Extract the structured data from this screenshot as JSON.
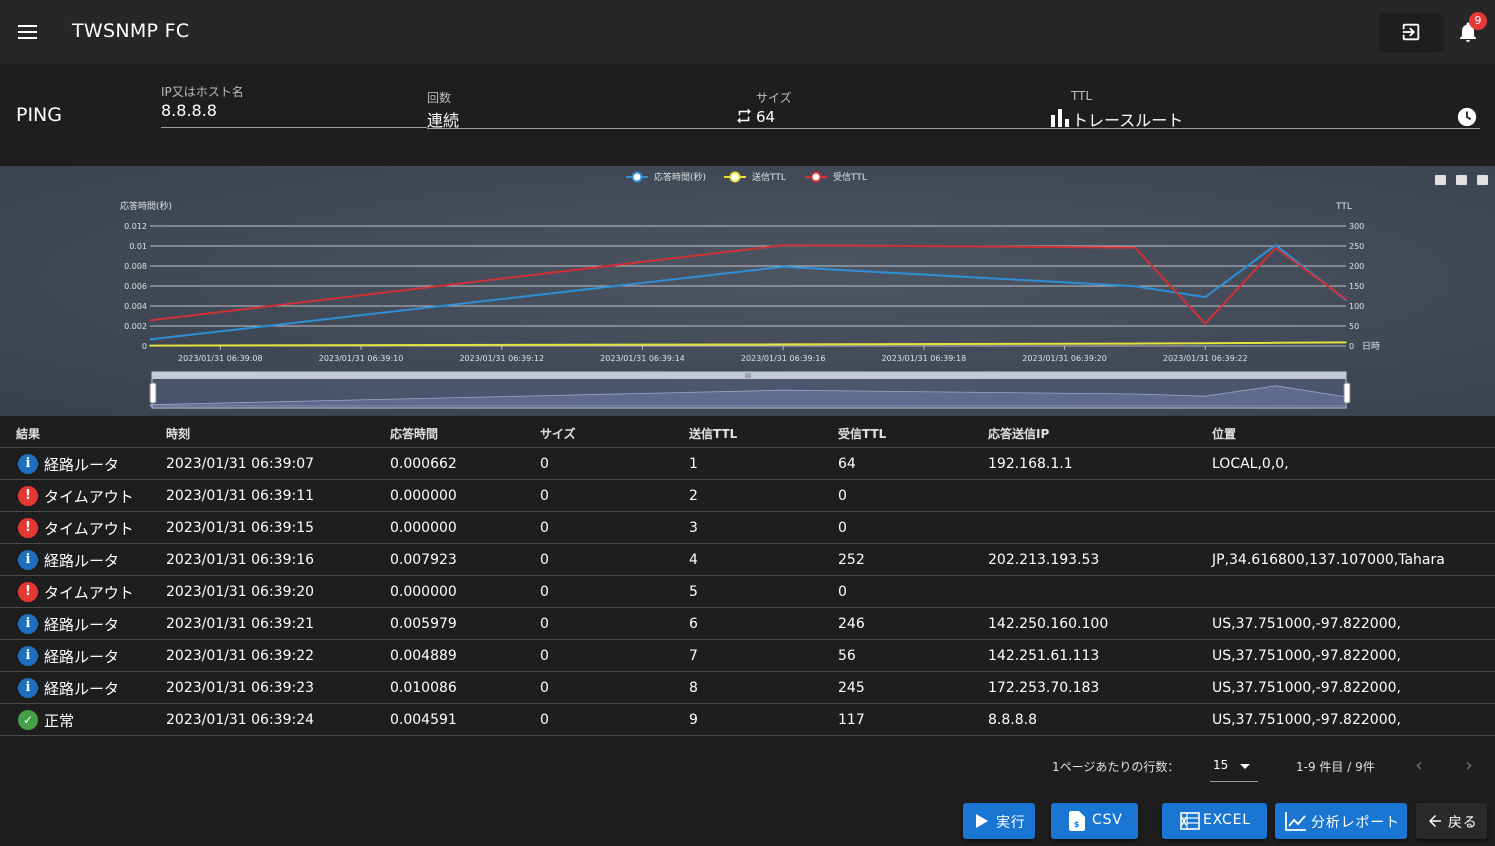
{
  "app": {
    "title": "TWSNMP FC",
    "notification_count": "9"
  },
  "page": {
    "title": "PING"
  },
  "form": {
    "host": {
      "label": "IP又はホスト名",
      "value": "8.8.8.8"
    },
    "count": {
      "label": "回数",
      "value": "連続"
    },
    "size": {
      "label": "サイズ",
      "value": "64"
    },
    "ttl": {
      "label": "TTL",
      "value": "トレースルート"
    }
  },
  "chart_data": {
    "type": "line",
    "legend": [
      "応答時間(秒)",
      "送信TTL",
      "受信TTL"
    ],
    "legend_position": "top-center",
    "ylabel_left": "応答時間(秒)",
    "ylabel_right": "TTL",
    "xlabel": "日時",
    "y_left_ticks": [
      "0",
      "0.002",
      "0.004",
      "0.006",
      "0.008",
      "0.01",
      "0.012"
    ],
    "y_left_range": [
      0,
      0.012
    ],
    "y_right_ticks": [
      "0",
      "50",
      "100",
      "150",
      "200",
      "250",
      "300"
    ],
    "y_right_range": [
      0,
      300
    ],
    "x_ticks": [
      "2023/01/31 06:39:08",
      "2023/01/31 06:39:10",
      "2023/01/31 06:39:12",
      "2023/01/31 06:39:14",
      "2023/01/31 06:39:16",
      "2023/01/31 06:39:18",
      "2023/01/31 06:39:20",
      "2023/01/31 06:39:22"
    ],
    "x_range_seconds": [
      7,
      24
    ],
    "grid": true,
    "series": [
      {
        "name": "応答時間(秒)",
        "axis": "left",
        "color": "#2e8fd6",
        "x": [
          7,
          16,
          21,
          22,
          23,
          24
        ],
        "values": [
          0.000662,
          0.007923,
          0.005979,
          0.004889,
          0.010086,
          0.004591
        ]
      },
      {
        "name": "送信TTL",
        "axis": "right",
        "color": "#e3e33a",
        "x": [
          7,
          16,
          21,
          22,
          23,
          24
        ],
        "values": [
          1,
          4,
          6,
          7,
          8,
          9
        ]
      },
      {
        "name": "受信TTL",
        "axis": "right",
        "color": "#d03036",
        "x": [
          7,
          16,
          21,
          22,
          23,
          24
        ],
        "values": [
          64,
          252,
          246,
          56,
          245,
          117
        ]
      }
    ]
  },
  "table": {
    "headers": [
      "結果",
      "時刻",
      "応答時間",
      "サイズ",
      "送信TTL",
      "受信TTL",
      "応答送信IP",
      "位置"
    ],
    "rows": [
      {
        "status": "info",
        "result": "経路ルータ",
        "time": "2023/01/31 06:39:07",
        "rtt": "0.000662",
        "size": "0",
        "send_ttl": "1",
        "recv_ttl": "64",
        "ip": "192.168.1.1",
        "loc": "LOCAL,0,0,"
      },
      {
        "status": "error",
        "result": "タイムアウト",
        "time": "2023/01/31 06:39:11",
        "rtt": "0.000000",
        "size": "0",
        "send_ttl": "2",
        "recv_ttl": "0",
        "ip": "",
        "loc": ""
      },
      {
        "status": "error",
        "result": "タイムアウト",
        "time": "2023/01/31 06:39:15",
        "rtt": "0.000000",
        "size": "0",
        "send_ttl": "3",
        "recv_ttl": "0",
        "ip": "",
        "loc": ""
      },
      {
        "status": "info",
        "result": "経路ルータ",
        "time": "2023/01/31 06:39:16",
        "rtt": "0.007923",
        "size": "0",
        "send_ttl": "4",
        "recv_ttl": "252",
        "ip": "202.213.193.53",
        "loc": "JP,34.616800,137.107000,Tahara"
      },
      {
        "status": "error",
        "result": "タイムアウト",
        "time": "2023/01/31 06:39:20",
        "rtt": "0.000000",
        "size": "0",
        "send_ttl": "5",
        "recv_ttl": "0",
        "ip": "",
        "loc": ""
      },
      {
        "status": "info",
        "result": "経路ルータ",
        "time": "2023/01/31 06:39:21",
        "rtt": "0.005979",
        "size": "0",
        "send_ttl": "6",
        "recv_ttl": "246",
        "ip": "142.250.160.100",
        "loc": "US,37.751000,-97.822000,"
      },
      {
        "status": "info",
        "result": "経路ルータ",
        "time": "2023/01/31 06:39:22",
        "rtt": "0.004889",
        "size": "0",
        "send_ttl": "7",
        "recv_ttl": "56",
        "ip": "142.251.61.113",
        "loc": "US,37.751000,-97.822000,"
      },
      {
        "status": "info",
        "result": "経路ルータ",
        "time": "2023/01/31 06:39:23",
        "rtt": "0.010086",
        "size": "0",
        "send_ttl": "8",
        "recv_ttl": "245",
        "ip": "172.253.70.183",
        "loc": "US,37.751000,-97.822000,"
      },
      {
        "status": "ok",
        "result": "正常",
        "time": "2023/01/31 06:39:24",
        "rtt": "0.004591",
        "size": "0",
        "send_ttl": "9",
        "recv_ttl": "117",
        "ip": "8.8.8.8",
        "loc": "US,37.751000,-97.822000,"
      }
    ]
  },
  "pagination": {
    "rows_per_page_label": "1ページあたりの行数：",
    "rows_per_page": "15",
    "range": "1-9 件目 / 9件"
  },
  "buttons": {
    "run": "実行",
    "csv": "CSV",
    "excel": "EXCEL",
    "report": "分析レポート",
    "back": "戻る"
  }
}
